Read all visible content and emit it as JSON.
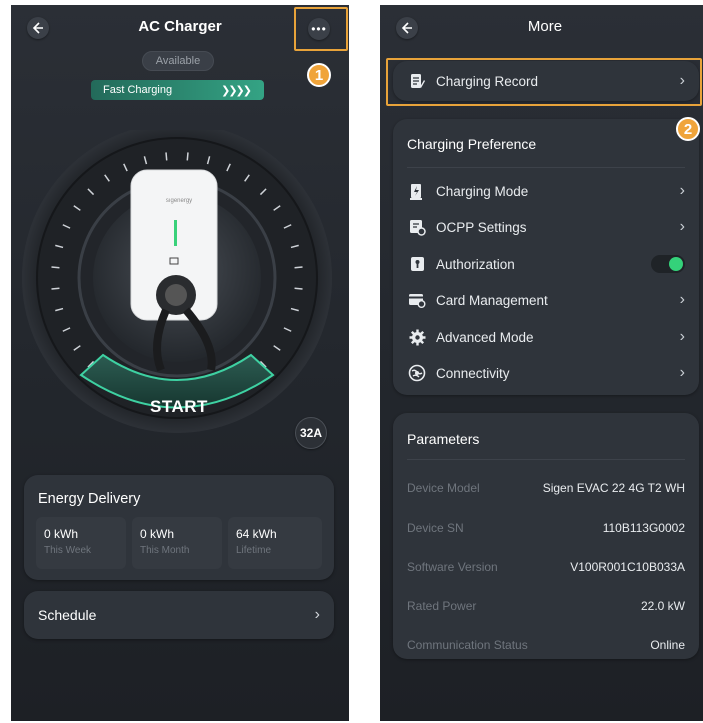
{
  "left": {
    "title": "AC Charger",
    "status": "Available",
    "fast_charging": "Fast Charging",
    "charger_brand": "sıgenergy",
    "start": "START",
    "current": "32A",
    "energy": {
      "title": "Energy Delivery",
      "stats": [
        {
          "value": "0 kWh",
          "label": "This Week"
        },
        {
          "value": "0 kWh",
          "label": "This Month"
        },
        {
          "value": "64 kWh",
          "label": "Lifetime"
        }
      ]
    },
    "schedule": "Schedule"
  },
  "right": {
    "title": "More",
    "charging_record": "Charging Record",
    "preference": {
      "title": "Charging Preference",
      "items": [
        {
          "label": "Charging Mode",
          "icon": "charging-mode-icon"
        },
        {
          "label": "OCPP Settings",
          "icon": "ocpp-settings-icon"
        },
        {
          "label": "Authorization",
          "icon": "authorization-icon",
          "toggle": true
        },
        {
          "label": "Card Management",
          "icon": "card-management-icon"
        },
        {
          "label": "Advanced Mode",
          "icon": "advanced-mode-icon"
        },
        {
          "label": "Connectivity",
          "icon": "connectivity-icon"
        }
      ]
    },
    "parameters": {
      "title": "Parameters",
      "rows": [
        {
          "key": "Device Model",
          "value": "Sigen EVAC 22 4G T2 WH"
        },
        {
          "key": "Device SN",
          "value": "110B113G0002"
        },
        {
          "key": "Software Version",
          "value": "V100R001C10B033A"
        },
        {
          "key": "Rated Power",
          "value": "22.0 kW"
        },
        {
          "key": "Communication Status",
          "value": "Online"
        }
      ]
    }
  },
  "annotations": [
    "1",
    "2"
  ],
  "colors": {
    "highlight": "#e8a33a",
    "accent_green": "#34d27a",
    "fast_charging_bg": "#2f8f74"
  }
}
